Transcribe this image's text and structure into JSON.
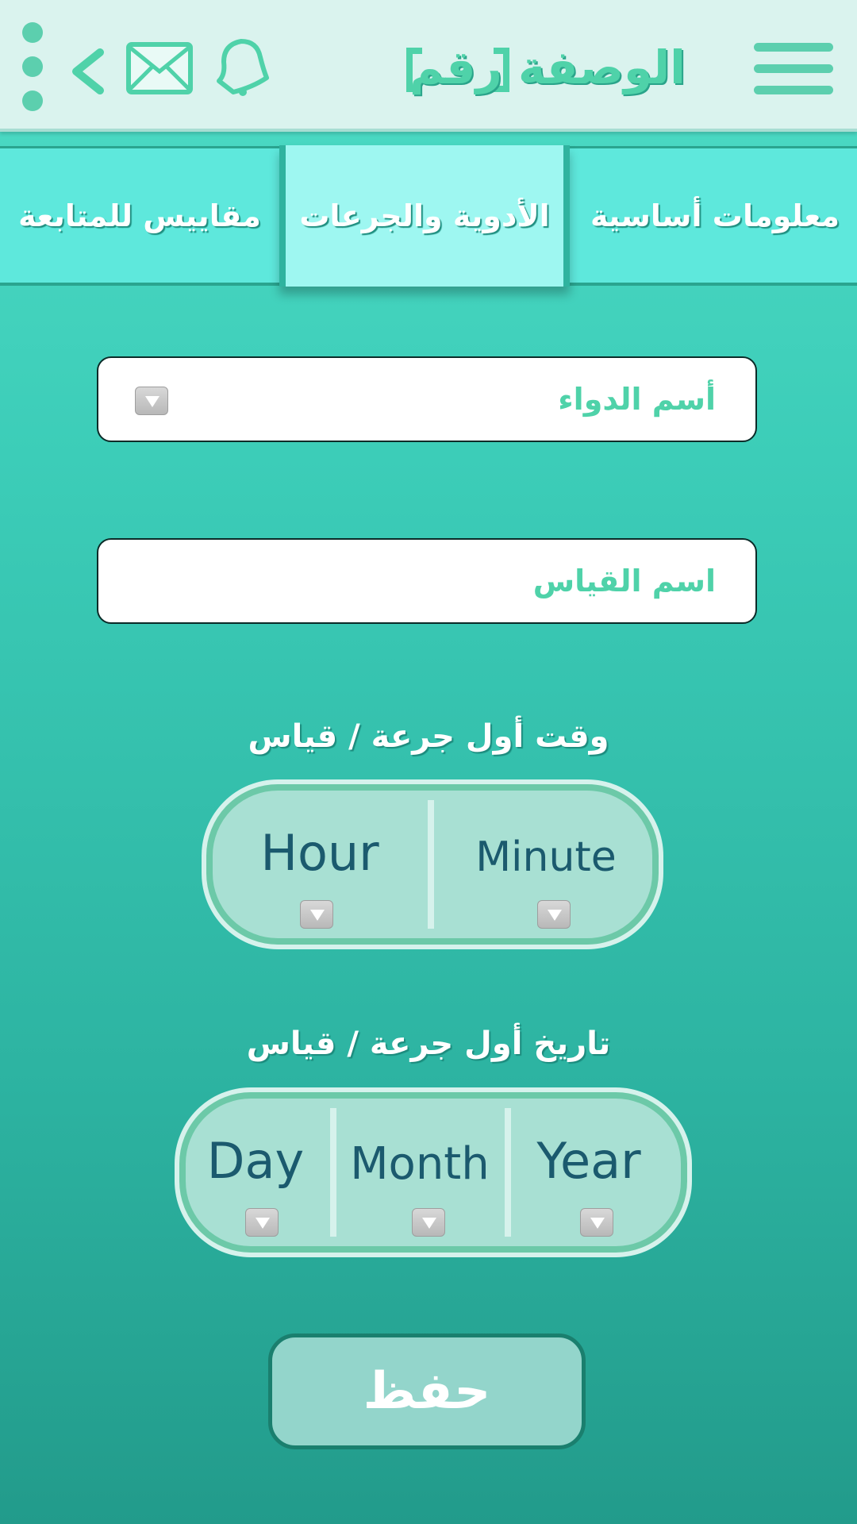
{
  "header": {
    "title": "الوصفة رقم",
    "title_number": "",
    "icons": [
      "more-vertical-icon",
      "back-arrow-icon",
      "mail-icon",
      "bell-icon",
      "hamburger-menu-icon"
    ]
  },
  "tabs": [
    {
      "label": "معلومات أساسية",
      "active": false
    },
    {
      "label": "الأدوية والجرعات",
      "active": true
    },
    {
      "label": "مقاييس للمتابعة",
      "active": false
    }
  ],
  "form": {
    "drug_name_placeholder": "أسم الدواء",
    "measure_name_placeholder": "اسم القياس",
    "first_dose_time_label": "وقت أول جرعة / قياس",
    "hour_label": "Hour",
    "minute_label": "Minute",
    "first_dose_date_label": "تاريخ أول جرعة / قياس",
    "day_label": "Day",
    "month_label": "Month",
    "year_label": "Year"
  },
  "save_label": "حفظ",
  "colors": {
    "accent": "#4fd2a9",
    "header_bg": "#daf3ee",
    "tab_bg": "#5ee8dc",
    "active_tab_bg": "#9ef7f1",
    "picker_bg": "#a8e0d3",
    "picker_text": "#1b5a6e"
  }
}
